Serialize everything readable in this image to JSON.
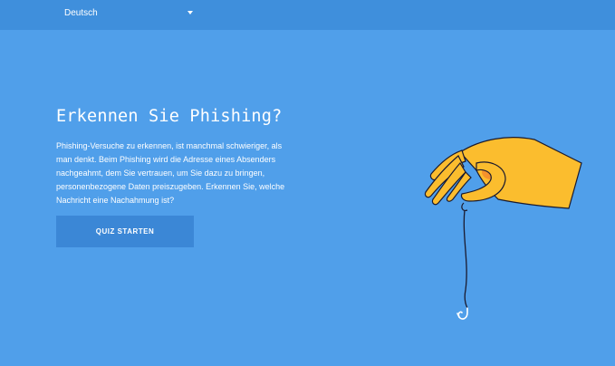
{
  "header": {
    "language": "Deutsch"
  },
  "hero": {
    "title": "Erkennen Sie Phishing?",
    "description": "Phishing-Versuche zu erkennen, ist manchmal schwieriger, als man denkt. Beim Phishing wird die Adresse eines Absenders nachgeahmt, dem Sie vertrauen, um Sie dazu zu bringen, personenbezogene Daten preiszugeben. Erkennen Sie, welche Nachricht eine Nachahmung ist?",
    "button_label": "QUIZ STARTEN"
  },
  "colors": {
    "background": "#509fea",
    "topbar": "#3f8fdc",
    "button": "#3b87d6",
    "hand": "#fbbd2e",
    "outline": "#1a1a2e"
  },
  "illustration": {
    "icon": "hand-with-fishing-hook-icon"
  }
}
